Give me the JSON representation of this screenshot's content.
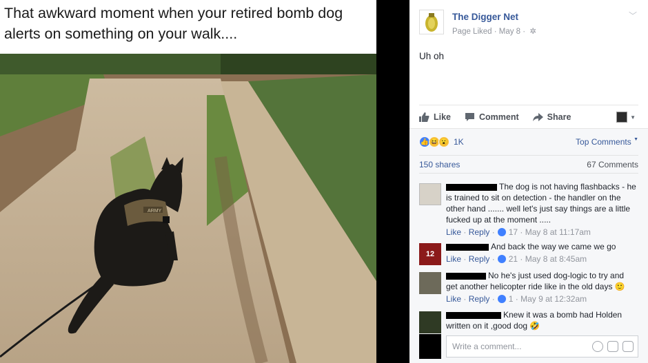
{
  "meme": {
    "caption": "That awkward moment when your retired bomb dog alerts on something on your walk....",
    "dog_vest_label": "ARMY"
  },
  "post": {
    "page_name": "The Digger Net",
    "meta": "Page Liked · May 8 ·",
    "text": "Uh oh",
    "actions": {
      "like": "Like",
      "comment": "Comment",
      "share": "Share"
    }
  },
  "stats": {
    "reaction_count": "1K",
    "top_comments": "Top Comments",
    "shares": "150 shares",
    "comments": "67 Comments"
  },
  "comments": [
    {
      "text": "The dog is not having flashbacks - he is trained to sit on detection - the handler on the other hand ....... well let's just say things are a little fucked up at the moment .....",
      "like": "Like",
      "reply": "Reply",
      "likes": "17",
      "time": "May 8 at 11:17am"
    },
    {
      "text": "And back the way we came we go",
      "like": "Like",
      "reply": "Reply",
      "likes": "21",
      "time": "May 8 at 8:45am",
      "avatar_label": "12"
    },
    {
      "text": "No he's just used dog-logic to try and get another helicopter ride like in the old days",
      "like": "Like",
      "reply": "Reply",
      "likes": "1",
      "time": "May 9 at 12:32am"
    },
    {
      "text": "Knew it was a bomb had Holden written on it ,good dog"
    }
  ],
  "composer": {
    "placeholder": "Write a comment..."
  },
  "colors": {
    "link": "#365899",
    "meta": "#90949c",
    "like_blue": "#4080ff",
    "panel_bg": "#f6f7f9"
  }
}
